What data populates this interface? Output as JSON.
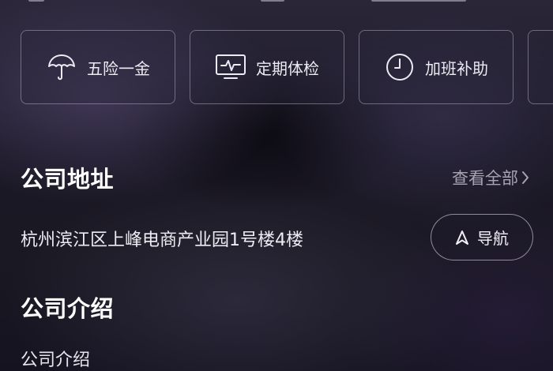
{
  "benefits": [
    {
      "label": "五险一金",
      "icon": "umbrella-icon"
    },
    {
      "label": "定期体检",
      "icon": "monitor-pulse-icon"
    },
    {
      "label": "加班补助",
      "icon": "clock-icon"
    }
  ],
  "address_section": {
    "title": "公司地址",
    "view_all": "查看全部",
    "address": "杭州滨江区上峰电商产业园1号楼4楼",
    "nav_label": "导航"
  },
  "intro_section": {
    "title": "公司介绍",
    "text": "公司介绍"
  },
  "colors": {
    "text_primary": "#ffffff",
    "text_secondary": "#a7a3b3",
    "border": "#d7d3e4"
  }
}
